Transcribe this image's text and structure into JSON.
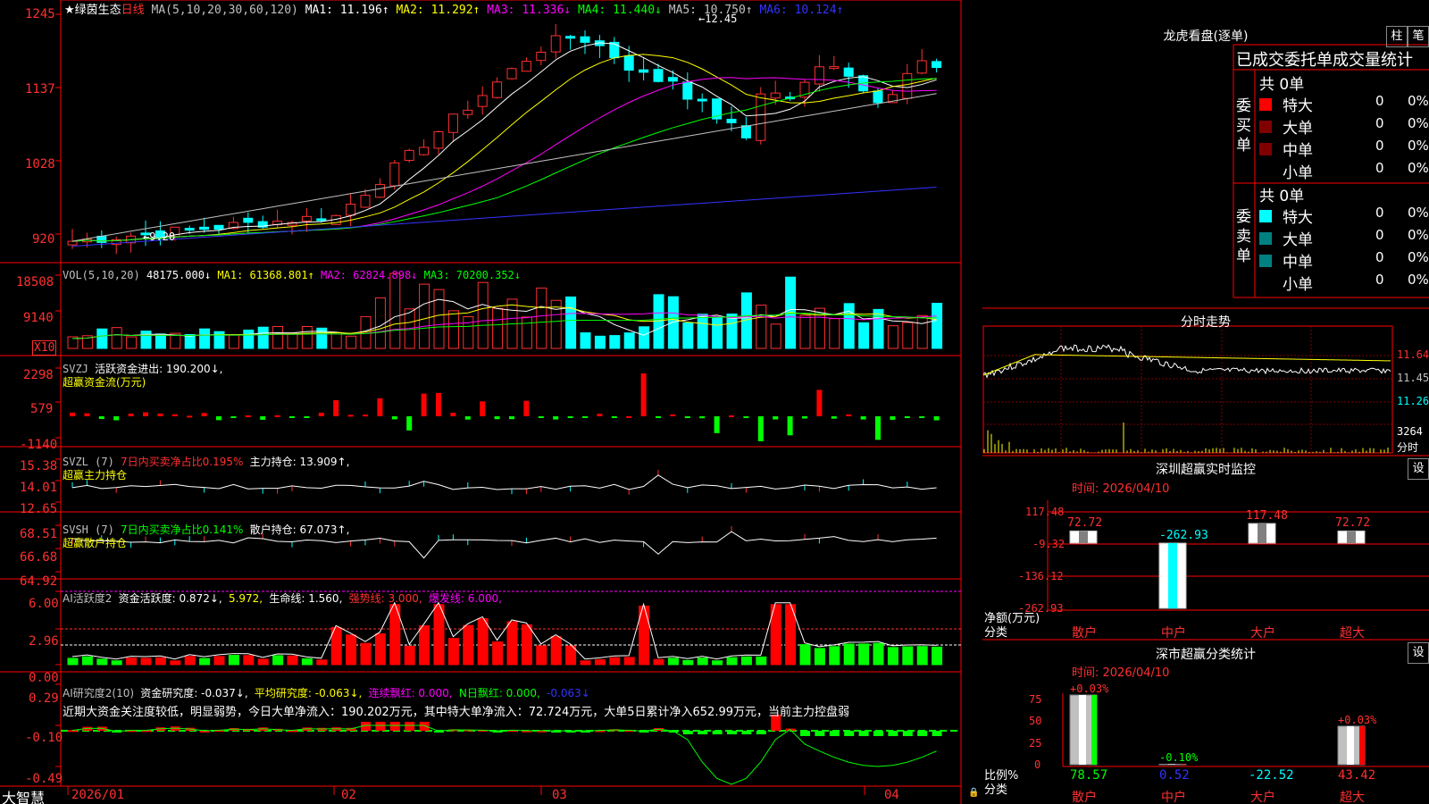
{
  "main": {
    "stock_title": "★绿茵生态",
    "period": "日线",
    "app_name": "大智慧",
    "price_pane": {
      "ma_params": "MA(5,10,20,30,60,120)",
      "ma1": "MA1: 11.196↑",
      "ma2": "MA2: 11.292↑",
      "ma3": "MA3: 11.336↓",
      "ma4": "MA4: 11.440↓",
      "ma5": "MA5: 10.750↑",
      "ma6": "MA6: 10.124↑",
      "high_note": "12.45",
      "low_note": "9.20",
      "y_labels": [
        "1245",
        "1137",
        "1028",
        "920"
      ]
    },
    "vol_pane": {
      "params": "VOL(5,10,20)",
      "vol": "48175.000↓",
      "ma1": "MA1: 61368.801↑",
      "ma2": "MA2: 62824.898↓",
      "ma3": "MA3: 70200.352↓",
      "y_labels": [
        "18508",
        "9140"
      ],
      "unit": "X10"
    },
    "svzj_pane": {
      "name": "SVZJ",
      "value": "活跃资金进出: 190.200↓,",
      "sub": "超赢资金流(万元)",
      "y_labels": [
        "2298",
        "579",
        "-1140"
      ]
    },
    "svzl_pane": {
      "name": "SVZL  (7)",
      "ratio": "7日内买卖净占比0.195%",
      "value": "主力持仓: 13.909↑,",
      "sub": "超赢主力持仓",
      "y_labels": [
        "15.38",
        "14.01",
        "12.65"
      ]
    },
    "svsh_pane": {
      "name": "SVSH  (7)",
      "ratio": "7日内买卖净占比0.141%",
      "value": "散户持仓: 67.073↑,",
      "sub": "超赢散户持仓",
      "y_labels": [
        "68.51",
        "66.68",
        "64.92"
      ]
    },
    "ai_active_pane": {
      "name": "AI活跃度2",
      "v1": "资金活跃度: 0.872↓,",
      "v2": "5.972,",
      "v3": "生命线: 1.560,",
      "v4": "强势线: 3.000,",
      "v5": "爆发线: 6.000,",
      "y_labels": [
        "6.00",
        "2.96",
        "0.00"
      ]
    },
    "ai_research_pane": {
      "name": "AI研究度2(10)",
      "v1": "资金研究度: -0.037↓,",
      "v2": "平均研究度: -0.063↓,",
      "v3": "连续飘红: 0.000,",
      "v4": "N日飘红: 0.000,",
      "v5": "-0.063↓",
      "comment": "近期大资金关注度较低，明显弱势，今日大单净流入：190.202万元，其中特大单净流入：72.724万元，大单5日累计净入652.99万元，当前主力控盘弱",
      "y_labels": [
        "0.29",
        "-0.10",
        "-0.49"
      ]
    },
    "x_labels": [
      "2026/01",
      "02",
      "03",
      "04"
    ]
  },
  "lhb": {
    "title": "龙虎看盘(逐单)",
    "btn_bar": "柱",
    "btn_pen": "笔",
    "header": "已成交委托单成交量统计",
    "buy": {
      "side_label": "委买单",
      "total": "共 0单",
      "rows": [
        {
          "label": "特大",
          "count": "0",
          "pct": "0%",
          "color": "#ff0000"
        },
        {
          "label": "大单",
          "count": "0",
          "pct": "0%",
          "color": "#800000"
        },
        {
          "label": "中单",
          "count": "0",
          "pct": "0%",
          "color": "#800000"
        },
        {
          "label": "小单",
          "count": "0",
          "pct": "0%",
          "color": ""
        }
      ]
    },
    "sell": {
      "side_label": "委卖单",
      "total": "共 0单",
      "rows": [
        {
          "label": "特大",
          "count": "0",
          "pct": "0%",
          "color": "#00ffff"
        },
        {
          "label": "大单",
          "count": "0",
          "pct": "0%",
          "color": "#008080"
        },
        {
          "label": "中单",
          "count": "0",
          "pct": "0%",
          "color": "#008080"
        },
        {
          "label": "小单",
          "count": "0",
          "pct": "0%",
          "color": ""
        }
      ]
    }
  },
  "intraday": {
    "title": "分时走势",
    "y_labels": [
      "11.64",
      "11.45",
      "11.26"
    ],
    "vol_label": "3264",
    "vol_unit": "分时"
  },
  "sz_monitor": {
    "title": "深圳超赢实时监控",
    "btn": "设",
    "time": "时间: 2026/04/10",
    "y_labels": [
      "117.48",
      "-9.32",
      "-136.12",
      "-262.93"
    ],
    "axis_caption_1": "净额(万元)",
    "axis_caption_2": "分类",
    "categories": [
      "散户",
      "中户",
      "大户",
      "超大"
    ],
    "values": [
      72.72,
      -262.93,
      117.48,
      72.72
    ],
    "value_labels": [
      "72.72",
      "-262.93",
      "117.48",
      "72.72"
    ]
  },
  "sz_classify": {
    "title": "深市超赢分类统计",
    "btn": "设",
    "time": "时间: 2026/04/10",
    "y_labels": [
      "75",
      "50",
      "25",
      "0"
    ],
    "axis_caption_1": "比例%",
    "axis_caption_2": "分类",
    "categories": [
      "散户",
      "中户",
      "大户",
      "超大"
    ],
    "top_labels": [
      "+0.03%",
      "-0.10%",
      "",
      "+0.03%"
    ],
    "bottom_values": [
      "78.57",
      "0.52",
      "-22.52",
      "43.42"
    ],
    "percents": [
      78.57,
      0.52,
      0,
      43.42
    ]
  },
  "chart_data": [
    {
      "type": "bar",
      "title": "深圳超赢实时监控",
      "categories": [
        "散户",
        "中户",
        "大户",
        "超大"
      ],
      "values": [
        72.72,
        -262.93,
        117.48,
        72.72
      ],
      "ylabel": "净额(万元)",
      "xlabel": "分类",
      "ylim": [
        -262.93,
        117.48
      ]
    },
    {
      "type": "bar",
      "title": "深市超赢分类统计",
      "categories": [
        "散户",
        "中户",
        "大户",
        "超大"
      ],
      "values": [
        78.57,
        0.52,
        -22.52,
        43.42
      ],
      "ylabel": "比例%",
      "xlabel": "分类",
      "ylim": [
        0,
        75
      ]
    }
  ]
}
